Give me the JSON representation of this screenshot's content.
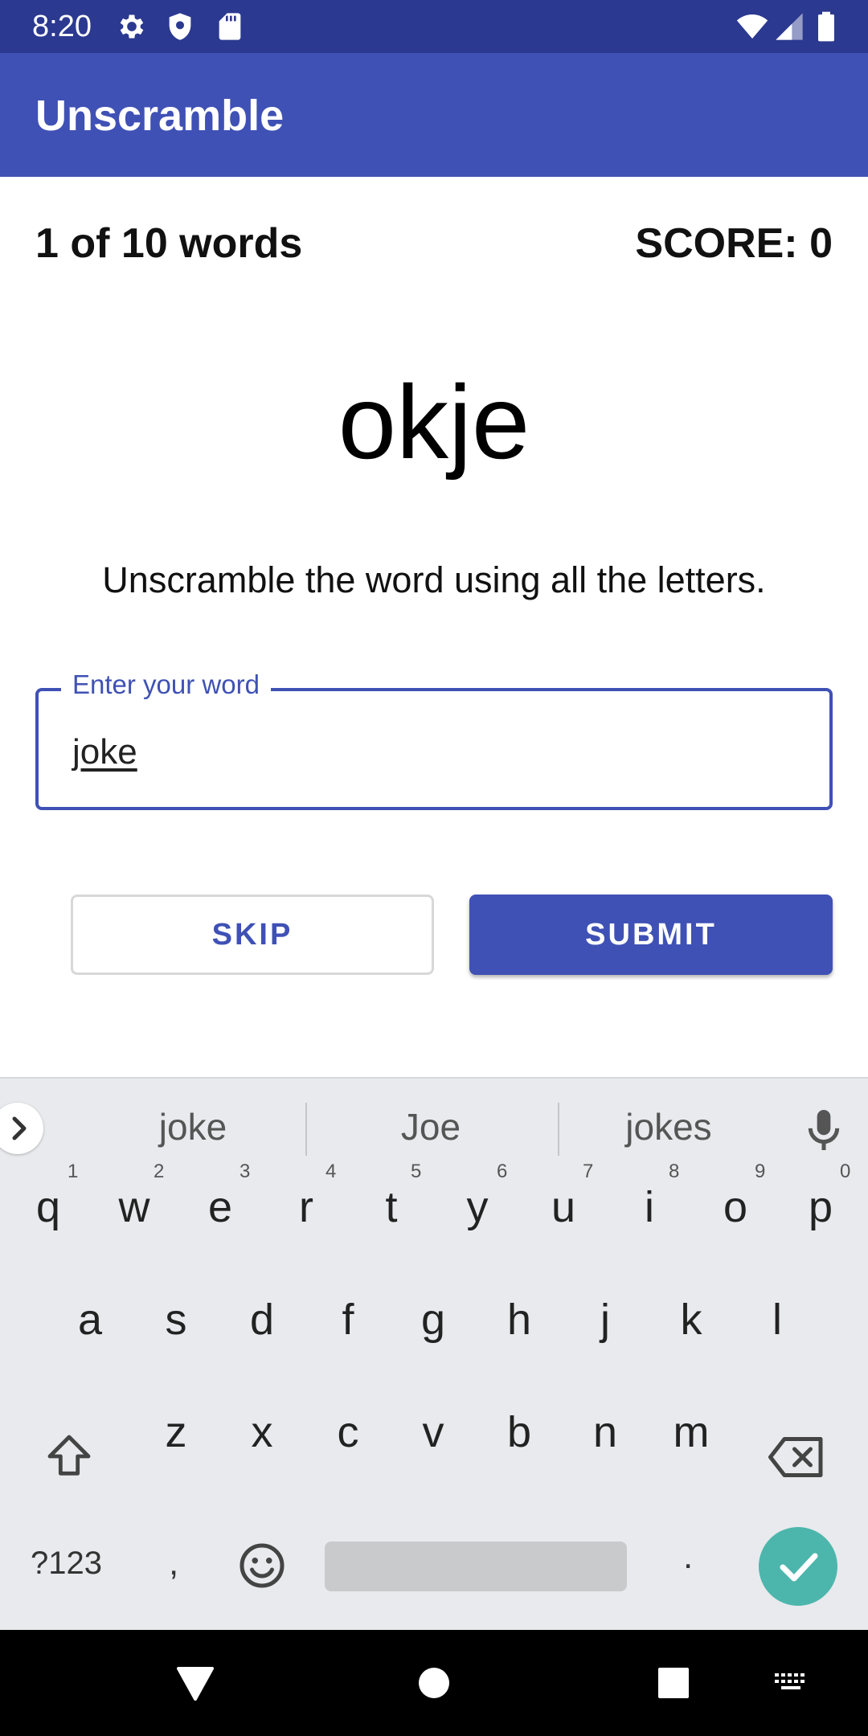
{
  "status_bar": {
    "time": "8:20"
  },
  "app_bar": {
    "title": "Unscramble"
  },
  "game": {
    "word_count": "1 of 10 words",
    "score": "SCORE: 0",
    "scrambled_word": "okje",
    "instructions": "Unscramble the word using all the letters.",
    "input": {
      "label": "Enter your word",
      "value": "joke"
    }
  },
  "buttons": {
    "skip": "SKIP",
    "submit": "SUBMIT"
  },
  "keyboard": {
    "suggestions": [
      "joke",
      "Joe",
      "jokes"
    ],
    "row1": [
      "q",
      "w",
      "e",
      "r",
      "t",
      "y",
      "u",
      "i",
      "o",
      "p"
    ],
    "row1_hints": [
      "1",
      "2",
      "3",
      "4",
      "5",
      "6",
      "7",
      "8",
      "9",
      "0"
    ],
    "row2": [
      "a",
      "s",
      "d",
      "f",
      "g",
      "h",
      "j",
      "k",
      "l"
    ],
    "row3": [
      "z",
      "x",
      "c",
      "v",
      "b",
      "n",
      "m"
    ],
    "symbols_key": "?123",
    "comma_key": ",",
    "period_key": ".",
    "accent_color": "#4db6ac"
  },
  "theme": {
    "primary": "#3f51b5",
    "primary_dark": "#2b3990"
  }
}
